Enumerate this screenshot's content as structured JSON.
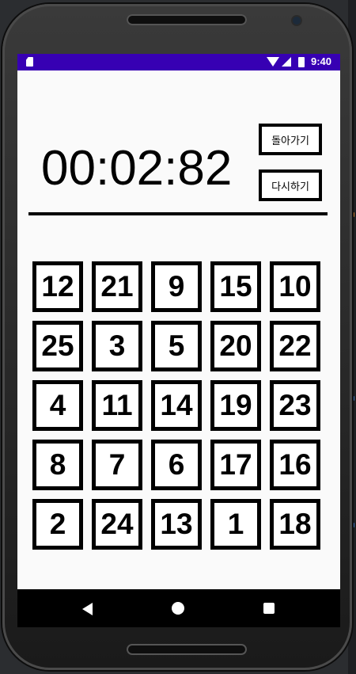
{
  "statusbar": {
    "time": "9:40",
    "icons": [
      "sd-card-icon",
      "wifi-icon",
      "signal-icon",
      "battery-icon"
    ],
    "color": "#3700b3"
  },
  "game": {
    "timer": "00:02:82",
    "back_label": "돌아가기",
    "retry_label": "다시하기",
    "tiles": [
      "12",
      "21",
      "9",
      "15",
      "10",
      "25",
      "3",
      "5",
      "20",
      "22",
      "4",
      "11",
      "14",
      "19",
      "23",
      "8",
      "7",
      "6",
      "17",
      "16",
      "2",
      "24",
      "13",
      "1",
      "18"
    ]
  },
  "navbar": {
    "icons": [
      "back-icon",
      "home-icon",
      "recents-icon"
    ]
  }
}
